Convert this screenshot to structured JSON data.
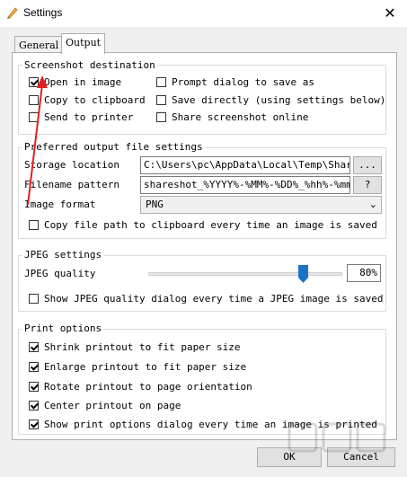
{
  "window": {
    "title": "Settings",
    "close_glyph": "✕"
  },
  "tabs": [
    "General",
    "Output"
  ],
  "screenshot_destination": {
    "title": "Screenshot destination",
    "options": [
      {
        "label": "Open in image",
        "checked": true
      },
      {
        "label": "Prompt dialog to save as",
        "checked": false
      },
      {
        "label": "Copy to clipboard",
        "checked": false
      },
      {
        "label": "Save directly (using settings below)",
        "checked": false
      },
      {
        "label": "Send to printer",
        "checked": false
      },
      {
        "label": "Share screenshot online",
        "checked": false
      }
    ]
  },
  "output_file": {
    "title": "Preferred output file settings",
    "storage_label": "Storage location",
    "storage_value": "C:\\Users\\pc\\AppData\\Local\\Temp\\ShareSh",
    "browse_label": "...",
    "pattern_label": "Filename pattern",
    "pattern_value": "shareshot_%YYYY%-%MM%-%DD%_%hh%-%mm%-%",
    "help_label": "?",
    "format_label": "Image format",
    "format_value": "PNG",
    "copy_path_label": "Copy file path to clipboard every time an image is saved",
    "copy_path_checked": false
  },
  "jpeg": {
    "title": "JPEG settings",
    "quality_label": "JPEG quality",
    "quality_value": "80%",
    "quality_fraction": 0.8,
    "show_dialog_label": "Show JPEG quality dialog every time a JPEG image is saved",
    "show_dialog_checked": false
  },
  "print": {
    "title": "Print options",
    "options": [
      {
        "label": "Shrink printout to fit paper size",
        "checked": true
      },
      {
        "label": "Enlarge printout to fit paper size",
        "checked": true
      },
      {
        "label": "Rotate printout to page orientation",
        "checked": true
      },
      {
        "label": "Center printout on page",
        "checked": true
      },
      {
        "label": "Show print options dialog every time an image is printed",
        "checked": true
      }
    ]
  },
  "buttons": {
    "ok": "OK",
    "cancel": "Cancel"
  },
  "colors": {
    "annotation_arrow": "#e02020",
    "slider_thumb": "#1a73c8"
  }
}
